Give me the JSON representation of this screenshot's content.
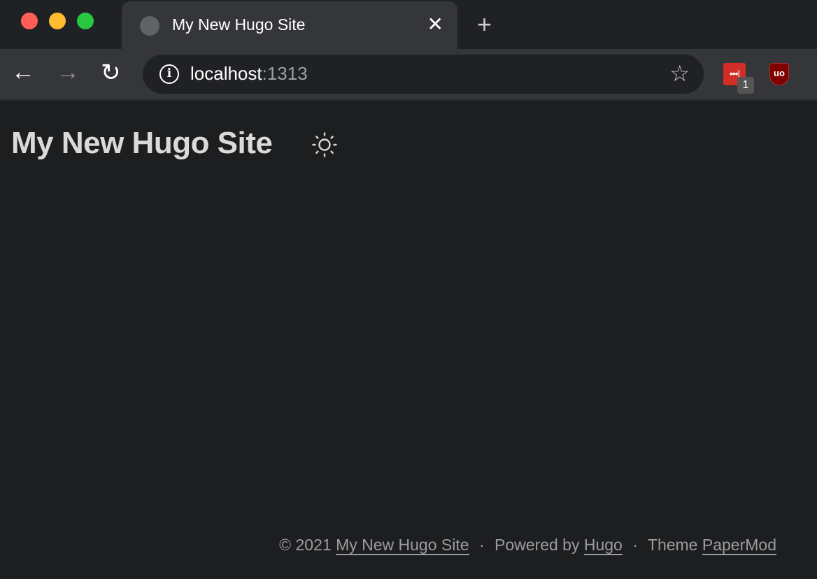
{
  "browser": {
    "tab_title": "My New Hugo Site",
    "close_label": "✕",
    "new_tab_label": "+",
    "url_host": "localhost",
    "url_port": ":1313",
    "extensions": [
      {
        "name": "LastPass",
        "label": "•••|",
        "badge": "1"
      },
      {
        "name": "uBlock Origin",
        "label": "uo"
      }
    ]
  },
  "page": {
    "site_title": "My New Hugo Site",
    "theme_toggle_icon": "sun-icon",
    "footer": {
      "copyright": "© 2021",
      "site_link": "My New Hugo Site",
      "separator": "·",
      "powered_by": "Powered by",
      "hugo_link": "Hugo",
      "theme": "Theme",
      "theme_link": "PaperMod"
    }
  }
}
